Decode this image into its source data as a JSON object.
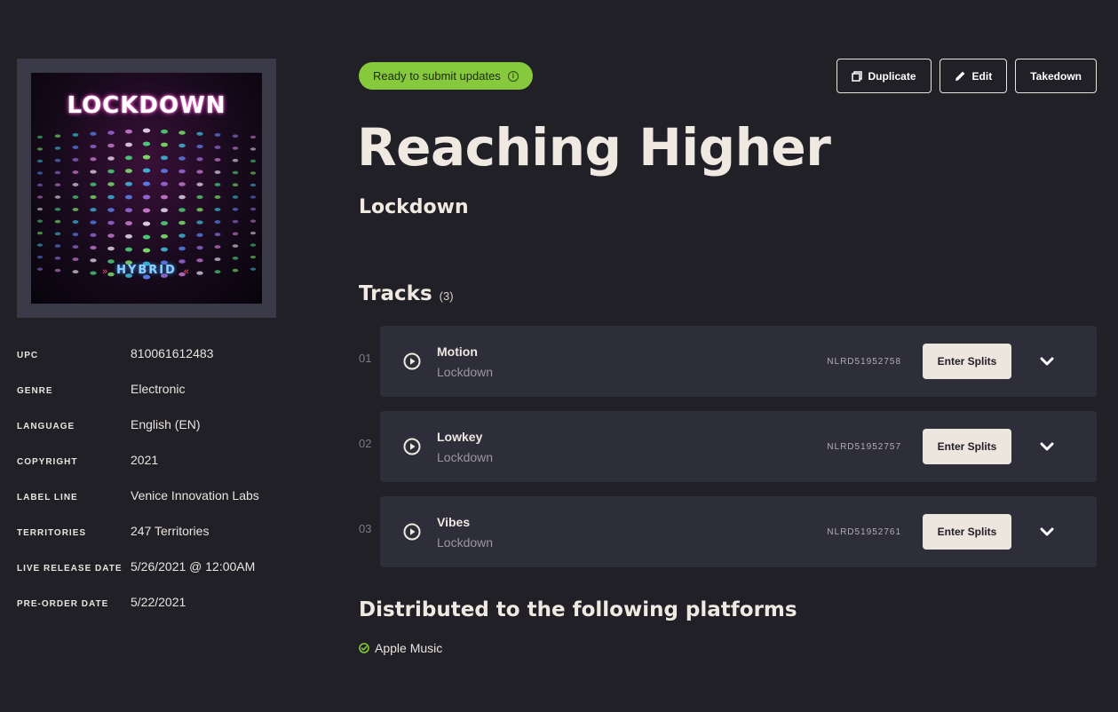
{
  "cover": {
    "title": "LOCKDOWN",
    "subtitle": "HYBRID"
  },
  "meta": [
    {
      "label": "UPC",
      "value": "810061612483"
    },
    {
      "label": "GENRE",
      "value": "Electronic"
    },
    {
      "label": "LANGUAGE",
      "value": "English (EN)"
    },
    {
      "label": "COPYRIGHT",
      "value": "2021"
    },
    {
      "label": "LABEL LINE",
      "value": "Venice Innovation Labs"
    },
    {
      "label": "TERRITORIES",
      "value": "247 Territories"
    },
    {
      "label": "LIVE RELEASE DATE",
      "value": "5/26/2021 @ 12:00AM"
    },
    {
      "label": "PRE-ORDER DATE",
      "value": "5/22/2021"
    }
  ],
  "status": {
    "label": "Ready to submit updates",
    "color": "#86c93c"
  },
  "actions": {
    "duplicate": "Duplicate",
    "edit": "Edit",
    "takedown": "Takedown"
  },
  "release": {
    "title": "Reaching Higher",
    "artist": "Lockdown"
  },
  "tracks": {
    "heading": "Tracks",
    "count": "(3)",
    "items": [
      {
        "number": "01",
        "title": "Motion",
        "artist": "Lockdown",
        "isrc": "NLRD51952758",
        "splits_label": "Enter Splits"
      },
      {
        "number": "02",
        "title": "Lowkey",
        "artist": "Lockdown",
        "isrc": "NLRD51952757",
        "splits_label": "Enter Splits"
      },
      {
        "number": "03",
        "title": "Vibes",
        "artist": "Lockdown",
        "isrc": "NLRD51952761",
        "splits_label": "Enter Splits"
      }
    ]
  },
  "platforms": {
    "heading": "Distributed to the following platforms",
    "items": [
      "Apple Music"
    ],
    "check_color": "#86c93c"
  }
}
